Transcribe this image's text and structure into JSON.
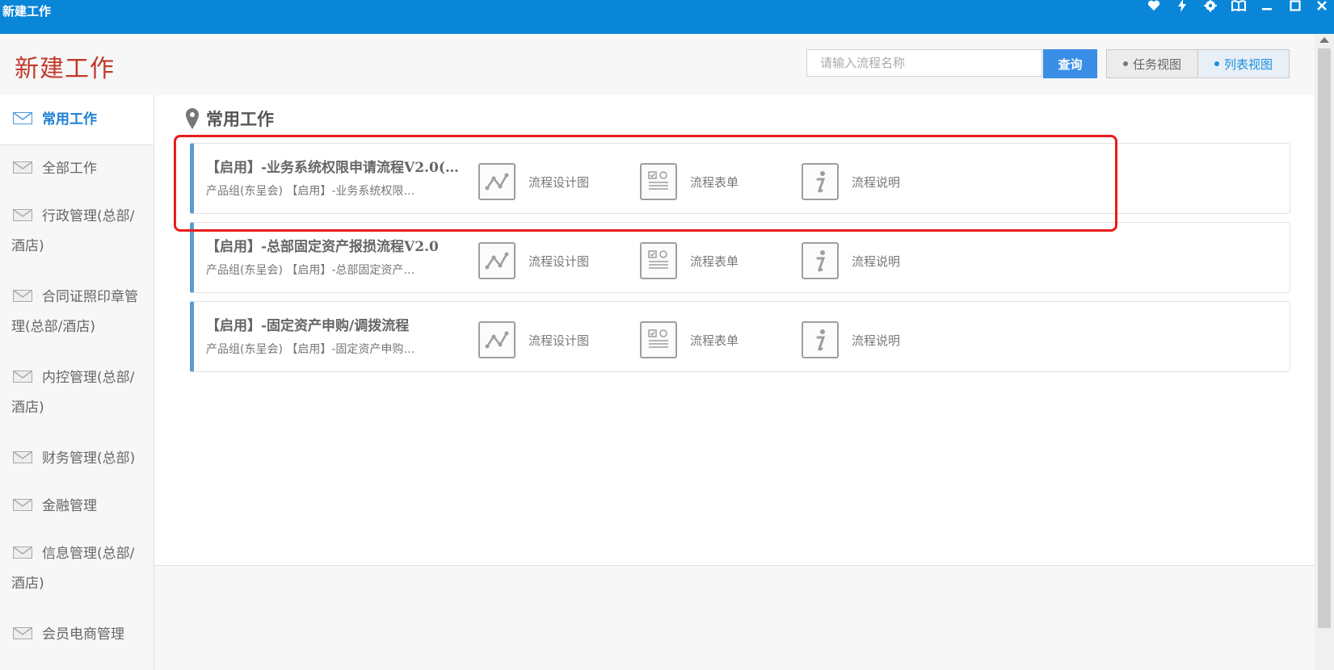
{
  "window": {
    "title": "新建工作",
    "controls": [
      "heart-icon",
      "lightning-icon",
      "gear-icon",
      "book-icon",
      "minimize-icon",
      "maximize-icon",
      "close-icon"
    ]
  },
  "header": {
    "title": "新建工作",
    "search": {
      "placeholder": "请输入流程名称",
      "value": ""
    },
    "search_button": "查询",
    "views": [
      {
        "label": "任务视图",
        "active": false
      },
      {
        "label": "列表视图",
        "active": true
      }
    ]
  },
  "sidebar": {
    "items": [
      {
        "label": "常用工作",
        "active": true
      },
      {
        "label": "全部工作",
        "active": false
      },
      {
        "label": "行政管理(总部/酒店)",
        "active": false
      },
      {
        "label": "合同证照印章管理(总部/酒店)",
        "active": false
      },
      {
        "label": "内控管理(总部/酒店)",
        "active": false
      },
      {
        "label": "财务管理(总部)",
        "active": false
      },
      {
        "label": "金融管理",
        "active": false
      },
      {
        "label": "信息管理(总部/酒店)",
        "active": false
      },
      {
        "label": "会员电商管理",
        "active": false
      }
    ]
  },
  "main": {
    "section_title": "常用工作",
    "cards": [
      {
        "title": "【启用】-业务系统权限申请流程V2.0(…",
        "subtitle": "产品组(东呈会) 【启用】-业务系统权限…"
      },
      {
        "title": "【启用】-总部固定资产报损流程V2.0",
        "subtitle": "产品组(东呈会) 【启用】-总部固定资产…"
      },
      {
        "title": "【启用】-固定资产申购/调拨流程",
        "subtitle": "产品组(东呈会) 【启用】-固定资产申购…"
      }
    ],
    "actions": {
      "design": "流程设计图",
      "form": "流程表单",
      "info": "流程说明"
    }
  },
  "colors": {
    "titlebar": "#0a86d8",
    "page_title": "#c0392b",
    "accent": "#1a7fd4",
    "highlight": "#e81c1c"
  }
}
